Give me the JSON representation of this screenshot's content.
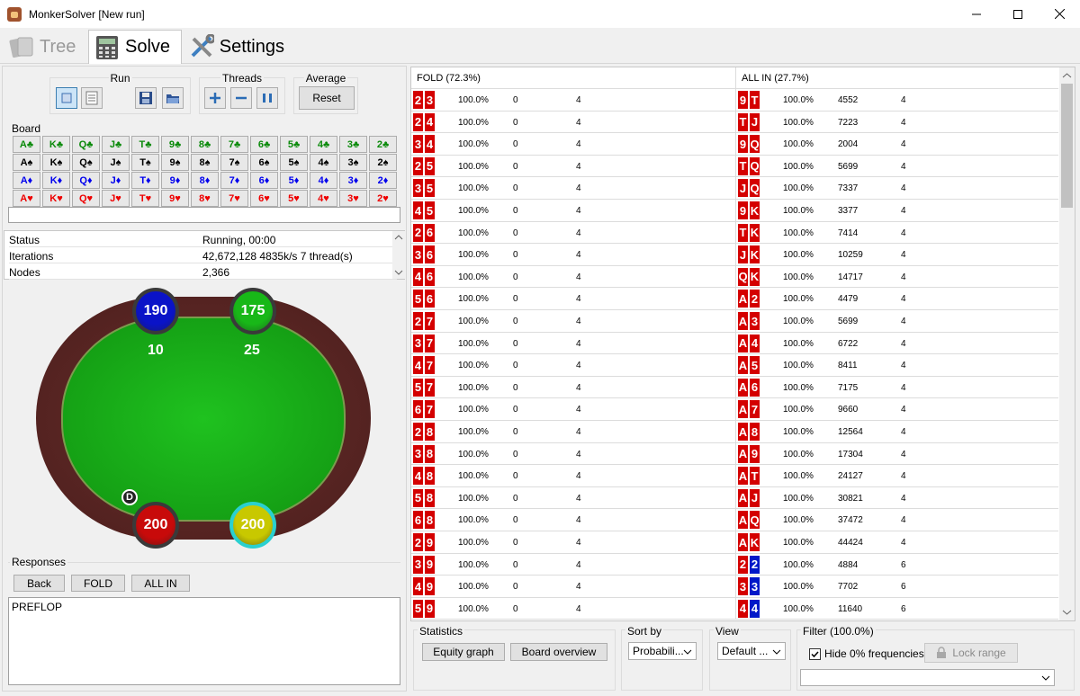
{
  "window": {
    "title": "MonkerSolver [New run]"
  },
  "tabs": [
    {
      "label": "Tree",
      "icon": "cards-icon"
    },
    {
      "label": "Solve",
      "icon": "calculator-icon"
    },
    {
      "label": "Settings",
      "icon": "tools-icon"
    }
  ],
  "run_group": {
    "label": "Run"
  },
  "threads_group": {
    "label": "Threads"
  },
  "average_group": {
    "label": "Average",
    "reset_label": "Reset"
  },
  "board": {
    "label": "Board",
    "rows": [
      {
        "suit": "clubs",
        "color": "#0a8a0a",
        "cards": [
          "A♣",
          "K♣",
          "Q♣",
          "J♣",
          "T♣",
          "9♣",
          "8♣",
          "7♣",
          "6♣",
          "5♣",
          "4♣",
          "3♣",
          "2♣"
        ]
      },
      {
        "suit": "spades",
        "color": "#000000",
        "cards": [
          "A♠",
          "K♠",
          "Q♠",
          "J♠",
          "T♠",
          "9♠",
          "8♠",
          "7♠",
          "6♠",
          "5♠",
          "4♠",
          "3♠",
          "2♠"
        ]
      },
      {
        "suit": "diamonds",
        "color": "#0000ee",
        "cards": [
          "A♦",
          "K♦",
          "Q♦",
          "J♦",
          "T♦",
          "9♦",
          "8♦",
          "7♦",
          "6♦",
          "5♦",
          "4♦",
          "3♦",
          "2♦"
        ]
      },
      {
        "suit": "hearts",
        "color": "#ee0000",
        "cards": [
          "A♥",
          "K♥",
          "Q♥",
          "J♥",
          "T♥",
          "9♥",
          "8♥",
          "7♥",
          "6♥",
          "5♥",
          "4♥",
          "3♥",
          "2♥"
        ]
      }
    ]
  },
  "stats": [
    {
      "label": "Status",
      "value": "Running, 00:00"
    },
    {
      "label": "Iterations",
      "value": "42,672,128  4835k/s 7 thread(s)"
    },
    {
      "label": "Nodes",
      "value": "2,366"
    }
  ],
  "table": {
    "players": [
      {
        "stack": "190",
        "bet": "10",
        "color": "#0a13c8"
      },
      {
        "stack": "175",
        "bet": "25",
        "color": "#18b818"
      },
      {
        "stack": "200",
        "bet": "",
        "color": "#c80a0a"
      },
      {
        "stack": "200",
        "bet": "",
        "color": "#c8c800"
      }
    ],
    "dealer_label": "D"
  },
  "responses": {
    "label": "Responses",
    "buttons": [
      "Back",
      "FOLD",
      "ALL IN"
    ],
    "history": "PREFLOP"
  },
  "hands": {
    "fold_header": "FOLD (72.3%)",
    "allin_header": "ALL IN (27.7%)",
    "fold_rows": [
      {
        "c1": "2",
        "c2": "3",
        "pct": "100.0%",
        "ev": "0",
        "n": "4"
      },
      {
        "c1": "2",
        "c2": "4",
        "pct": "100.0%",
        "ev": "0",
        "n": "4"
      },
      {
        "c1": "3",
        "c2": "4",
        "pct": "100.0%",
        "ev": "0",
        "n": "4"
      },
      {
        "c1": "2",
        "c2": "5",
        "pct": "100.0%",
        "ev": "0",
        "n": "4"
      },
      {
        "c1": "3",
        "c2": "5",
        "pct": "100.0%",
        "ev": "0",
        "n": "4"
      },
      {
        "c1": "4",
        "c2": "5",
        "pct": "100.0%",
        "ev": "0",
        "n": "4"
      },
      {
        "c1": "2",
        "c2": "6",
        "pct": "100.0%",
        "ev": "0",
        "n": "4"
      },
      {
        "c1": "3",
        "c2": "6",
        "pct": "100.0%",
        "ev": "0",
        "n": "4"
      },
      {
        "c1": "4",
        "c2": "6",
        "pct": "100.0%",
        "ev": "0",
        "n": "4"
      },
      {
        "c1": "5",
        "c2": "6",
        "pct": "100.0%",
        "ev": "0",
        "n": "4"
      },
      {
        "c1": "2",
        "c2": "7",
        "pct": "100.0%",
        "ev": "0",
        "n": "4"
      },
      {
        "c1": "3",
        "c2": "7",
        "pct": "100.0%",
        "ev": "0",
        "n": "4"
      },
      {
        "c1": "4",
        "c2": "7",
        "pct": "100.0%",
        "ev": "0",
        "n": "4"
      },
      {
        "c1": "5",
        "c2": "7",
        "pct": "100.0%",
        "ev": "0",
        "n": "4"
      },
      {
        "c1": "6",
        "c2": "7",
        "pct": "100.0%",
        "ev": "0",
        "n": "4"
      },
      {
        "c1": "2",
        "c2": "8",
        "pct": "100.0%",
        "ev": "0",
        "n": "4"
      },
      {
        "c1": "3",
        "c2": "8",
        "pct": "100.0%",
        "ev": "0",
        "n": "4"
      },
      {
        "c1": "4",
        "c2": "8",
        "pct": "100.0%",
        "ev": "0",
        "n": "4"
      },
      {
        "c1": "5",
        "c2": "8",
        "pct": "100.0%",
        "ev": "0",
        "n": "4"
      },
      {
        "c1": "6",
        "c2": "8",
        "pct": "100.0%",
        "ev": "0",
        "n": "4"
      },
      {
        "c1": "2",
        "c2": "9",
        "pct": "100.0%",
        "ev": "0",
        "n": "4"
      },
      {
        "c1": "3",
        "c2": "9",
        "pct": "100.0%",
        "ev": "0",
        "n": "4"
      },
      {
        "c1": "4",
        "c2": "9",
        "pct": "100.0%",
        "ev": "0",
        "n": "4"
      },
      {
        "c1": "5",
        "c2": "9",
        "pct": "100.0%",
        "ev": "0",
        "n": "4"
      }
    ],
    "allin_rows": [
      {
        "c1": "9",
        "c2": "T",
        "col2": "red",
        "pct": "100.0%",
        "ev": "4552",
        "n": "4"
      },
      {
        "c1": "T",
        "c2": "J",
        "col2": "red",
        "pct": "100.0%",
        "ev": "7223",
        "n": "4"
      },
      {
        "c1": "9",
        "c2": "Q",
        "col2": "red",
        "pct": "100.0%",
        "ev": "2004",
        "n": "4"
      },
      {
        "c1": "T",
        "c2": "Q",
        "col2": "red",
        "pct": "100.0%",
        "ev": "5699",
        "n": "4"
      },
      {
        "c1": "J",
        "c2": "Q",
        "col2": "red",
        "pct": "100.0%",
        "ev": "7337",
        "n": "4"
      },
      {
        "c1": "9",
        "c2": "K",
        "col2": "red",
        "pct": "100.0%",
        "ev": "3377",
        "n": "4"
      },
      {
        "c1": "T",
        "c2": "K",
        "col2": "red",
        "pct": "100.0%",
        "ev": "7414",
        "n": "4"
      },
      {
        "c1": "J",
        "c2": "K",
        "col2": "red",
        "pct": "100.0%",
        "ev": "10259",
        "n": "4"
      },
      {
        "c1": "Q",
        "c2": "K",
        "col2": "red",
        "pct": "100.0%",
        "ev": "14717",
        "n": "4"
      },
      {
        "c1": "A",
        "c2": "2",
        "col2": "red",
        "pct": "100.0%",
        "ev": "4479",
        "n": "4"
      },
      {
        "c1": "A",
        "c2": "3",
        "col2": "red",
        "pct": "100.0%",
        "ev": "5699",
        "n": "4"
      },
      {
        "c1": "A",
        "c2": "4",
        "col2": "red",
        "pct": "100.0%",
        "ev": "6722",
        "n": "4"
      },
      {
        "c1": "A",
        "c2": "5",
        "col2": "red",
        "pct": "100.0%",
        "ev": "8411",
        "n": "4"
      },
      {
        "c1": "A",
        "c2": "6",
        "col2": "red",
        "pct": "100.0%",
        "ev": "7175",
        "n": "4"
      },
      {
        "c1": "A",
        "c2": "7",
        "col2": "red",
        "pct": "100.0%",
        "ev": "9660",
        "n": "4"
      },
      {
        "c1": "A",
        "c2": "8",
        "col2": "red",
        "pct": "100.0%",
        "ev": "12564",
        "n": "4"
      },
      {
        "c1": "A",
        "c2": "9",
        "col2": "red",
        "pct": "100.0%",
        "ev": "17304",
        "n": "4"
      },
      {
        "c1": "A",
        "c2": "T",
        "col2": "red",
        "pct": "100.0%",
        "ev": "24127",
        "n": "4"
      },
      {
        "c1": "A",
        "c2": "J",
        "col2": "red",
        "pct": "100.0%",
        "ev": "30821",
        "n": "4"
      },
      {
        "c1": "A",
        "c2": "Q",
        "col2": "red",
        "pct": "100.0%",
        "ev": "37472",
        "n": "4"
      },
      {
        "c1": "A",
        "c2": "K",
        "col2": "red",
        "pct": "100.0%",
        "ev": "44424",
        "n": "4"
      },
      {
        "c1": "2",
        "c2": "2",
        "col2": "blue",
        "pct": "100.0%",
        "ev": "4884",
        "n": "6"
      },
      {
        "c1": "3",
        "c2": "3",
        "col2": "blue",
        "pct": "100.0%",
        "ev": "7702",
        "n": "6"
      },
      {
        "c1": "4",
        "c2": "4",
        "col2": "blue",
        "pct": "100.0%",
        "ev": "11640",
        "n": "6"
      }
    ]
  },
  "bottom": {
    "statistics_label": "Statistics",
    "equity_graph_label": "Equity graph",
    "board_overview_label": "Board overview",
    "sort_by_label": "Sort by",
    "sort_value": "Probabili...",
    "view_label": "View",
    "view_value": "Default ...",
    "filter_label": "Filter (100.0%)",
    "hide_zero_label": "Hide 0% frequencies",
    "lock_range_label": "Lock range"
  }
}
